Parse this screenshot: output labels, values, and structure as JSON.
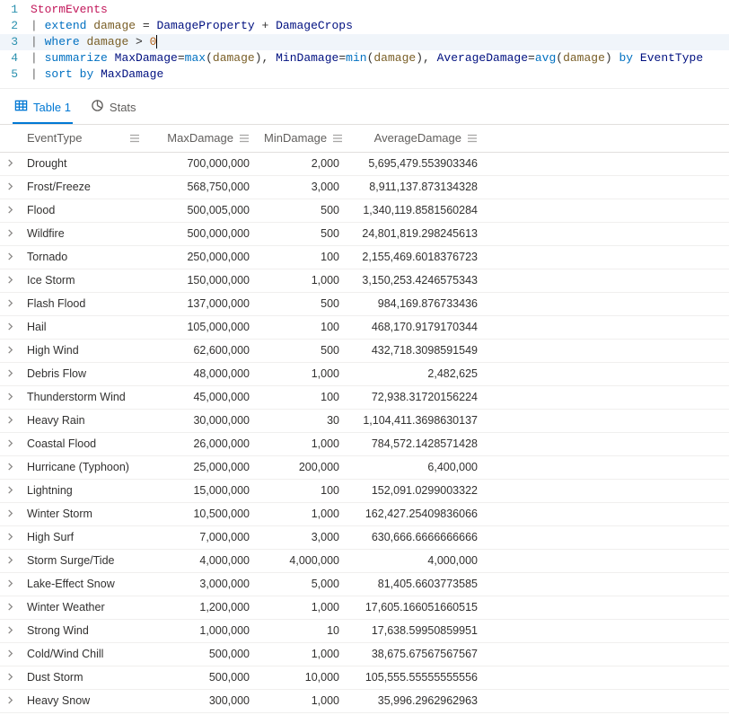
{
  "code": {
    "lines": [
      {
        "n": 1,
        "hl": false,
        "tokens": [
          {
            "t": "StormEvents",
            "c": "tk-id"
          }
        ]
      },
      {
        "n": 2,
        "hl": false,
        "tokens": [
          {
            "t": "| ",
            "c": "tk-pipe"
          },
          {
            "t": "extend",
            "c": "tk-kw"
          },
          {
            "t": " ",
            "c": ""
          },
          {
            "t": "damage",
            "c": "tk-var"
          },
          {
            "t": " = ",
            "c": "tk-op"
          },
          {
            "t": "DamageProperty",
            "c": "tk-col"
          },
          {
            "t": " + ",
            "c": "tk-op"
          },
          {
            "t": "DamageCrops",
            "c": "tk-col"
          }
        ]
      },
      {
        "n": 3,
        "hl": true,
        "cursorAfter": true,
        "tokens": [
          {
            "t": "| ",
            "c": "tk-pipe"
          },
          {
            "t": "where",
            "c": "tk-kw"
          },
          {
            "t": " ",
            "c": ""
          },
          {
            "t": "damage",
            "c": "tk-var"
          },
          {
            "t": " > ",
            "c": "tk-op"
          },
          {
            "t": "0",
            "c": "tk-num"
          }
        ]
      },
      {
        "n": 4,
        "hl": false,
        "tokens": [
          {
            "t": "| ",
            "c": "tk-pipe"
          },
          {
            "t": "summarize",
            "c": "tk-kw"
          },
          {
            "t": " ",
            "c": ""
          },
          {
            "t": "MaxDamage",
            "c": "tk-col"
          },
          {
            "t": "=",
            "c": "tk-op"
          },
          {
            "t": "max",
            "c": "tk-kw"
          },
          {
            "t": "(",
            "c": "tk-op"
          },
          {
            "t": "damage",
            "c": "tk-var"
          },
          {
            "t": ")",
            "c": "tk-op"
          },
          {
            "t": ", ",
            "c": "tk-op"
          },
          {
            "t": "MinDamage",
            "c": "tk-col"
          },
          {
            "t": "=",
            "c": "tk-op"
          },
          {
            "t": "min",
            "c": "tk-kw"
          },
          {
            "t": "(",
            "c": "tk-op"
          },
          {
            "t": "damage",
            "c": "tk-var"
          },
          {
            "t": ")",
            "c": "tk-op"
          },
          {
            "t": ", ",
            "c": "tk-op"
          },
          {
            "t": "AverageDamage",
            "c": "tk-col"
          },
          {
            "t": "=",
            "c": "tk-op"
          },
          {
            "t": "avg",
            "c": "tk-kw"
          },
          {
            "t": "(",
            "c": "tk-op"
          },
          {
            "t": "damage",
            "c": "tk-var"
          },
          {
            "t": ")",
            "c": "tk-op"
          },
          {
            "t": " ",
            "c": ""
          },
          {
            "t": "by",
            "c": "tk-kw"
          },
          {
            "t": " ",
            "c": ""
          },
          {
            "t": "EventType",
            "c": "tk-col"
          }
        ]
      },
      {
        "n": 5,
        "hl": false,
        "tokens": [
          {
            "t": "| ",
            "c": "tk-pipe"
          },
          {
            "t": "sort",
            "c": "tk-kw"
          },
          {
            "t": " ",
            "c": ""
          },
          {
            "t": "by",
            "c": "tk-kw"
          },
          {
            "t": " ",
            "c": ""
          },
          {
            "t": "MaxDamage",
            "c": "tk-col"
          }
        ]
      }
    ]
  },
  "tabs": {
    "table": "Table 1",
    "stats": "Stats"
  },
  "table": {
    "headers": {
      "eventType": "EventType",
      "maxDamage": "MaxDamage",
      "minDamage": "MinDamage",
      "avgDamage": "AverageDamage"
    },
    "rows": [
      {
        "eventType": "Drought",
        "maxDamage": "700,000,000",
        "minDamage": "2,000",
        "avgDamage": "5,695,479.553903346"
      },
      {
        "eventType": "Frost/Freeze",
        "maxDamage": "568,750,000",
        "minDamage": "3,000",
        "avgDamage": "8,911,137.873134328"
      },
      {
        "eventType": "Flood",
        "maxDamage": "500,005,000",
        "minDamage": "500",
        "avgDamage": "1,340,119.8581560284"
      },
      {
        "eventType": "Wildfire",
        "maxDamage": "500,000,000",
        "minDamage": "500",
        "avgDamage": "24,801,819.298245613"
      },
      {
        "eventType": "Tornado",
        "maxDamage": "250,000,000",
        "minDamage": "100",
        "avgDamage": "2,155,469.6018376723"
      },
      {
        "eventType": "Ice Storm",
        "maxDamage": "150,000,000",
        "minDamage": "1,000",
        "avgDamage": "3,150,253.4246575343"
      },
      {
        "eventType": "Flash Flood",
        "maxDamage": "137,000,000",
        "minDamage": "500",
        "avgDamage": "984,169.876733436"
      },
      {
        "eventType": "Hail",
        "maxDamage": "105,000,000",
        "minDamage": "100",
        "avgDamage": "468,170.9179170344"
      },
      {
        "eventType": "High Wind",
        "maxDamage": "62,600,000",
        "minDamage": "500",
        "avgDamage": "432,718.3098591549"
      },
      {
        "eventType": "Debris Flow",
        "maxDamage": "48,000,000",
        "minDamage": "1,000",
        "avgDamage": "2,482,625"
      },
      {
        "eventType": "Thunderstorm Wind",
        "maxDamage": "45,000,000",
        "minDamage": "100",
        "avgDamage": "72,938.31720156224"
      },
      {
        "eventType": "Heavy Rain",
        "maxDamage": "30,000,000",
        "minDamage": "30",
        "avgDamage": "1,104,411.3698630137"
      },
      {
        "eventType": "Coastal Flood",
        "maxDamage": "26,000,000",
        "minDamage": "1,000",
        "avgDamage": "784,572.1428571428"
      },
      {
        "eventType": "Hurricane (Typhoon)",
        "maxDamage": "25,000,000",
        "minDamage": "200,000",
        "avgDamage": "6,400,000"
      },
      {
        "eventType": "Lightning",
        "maxDamage": "15,000,000",
        "minDamage": "100",
        "avgDamage": "152,091.0299003322"
      },
      {
        "eventType": "Winter Storm",
        "maxDamage": "10,500,000",
        "minDamage": "1,000",
        "avgDamage": "162,427.25409836066"
      },
      {
        "eventType": "High Surf",
        "maxDamage": "7,000,000",
        "minDamage": "3,000",
        "avgDamage": "630,666.6666666666"
      },
      {
        "eventType": "Storm Surge/Tide",
        "maxDamage": "4,000,000",
        "minDamage": "4,000,000",
        "avgDamage": "4,000,000"
      },
      {
        "eventType": "Lake-Effect Snow",
        "maxDamage": "3,000,000",
        "minDamage": "5,000",
        "avgDamage": "81,405.6603773585"
      },
      {
        "eventType": "Winter Weather",
        "maxDamage": "1,200,000",
        "minDamage": "1,000",
        "avgDamage": "17,605.166051660515"
      },
      {
        "eventType": "Strong Wind",
        "maxDamage": "1,000,000",
        "minDamage": "10",
        "avgDamage": "17,638.59950859951"
      },
      {
        "eventType": "Cold/Wind Chill",
        "maxDamage": "500,000",
        "minDamage": "1,000",
        "avgDamage": "38,675.67567567567"
      },
      {
        "eventType": "Dust Storm",
        "maxDamage": "500,000",
        "minDamage": "10,000",
        "avgDamage": "105,555.55555555556"
      },
      {
        "eventType": "Heavy Snow",
        "maxDamage": "300,000",
        "minDamage": "1,000",
        "avgDamage": "35,996.2962962963"
      }
    ]
  }
}
